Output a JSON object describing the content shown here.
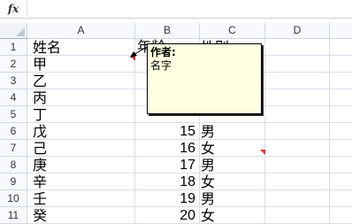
{
  "formula_bar": {
    "fx_label": "fx",
    "value": ""
  },
  "columns": [
    "A",
    "B",
    "C",
    "D"
  ],
  "rows": [
    {
      "num": "1",
      "a": "姓名",
      "b": "年龄",
      "c": "性别"
    },
    {
      "num": "2",
      "a": "甲",
      "b": "",
      "c": ""
    },
    {
      "num": "3",
      "a": "乙",
      "b": "",
      "c": ""
    },
    {
      "num": "4",
      "a": "丙",
      "b": "",
      "c": ""
    },
    {
      "num": "5",
      "a": "丁",
      "b": "",
      "c": ""
    },
    {
      "num": "6",
      "a": "戊",
      "b": "15",
      "c": "男"
    },
    {
      "num": "7",
      "a": "己",
      "b": "16",
      "c": "女"
    },
    {
      "num": "8",
      "a": "庚",
      "b": "17",
      "c": "男"
    },
    {
      "num": "9",
      "a": "辛",
      "b": "18",
      "c": "女"
    },
    {
      "num": "10",
      "a": "壬",
      "b": "19",
      "c": "男"
    },
    {
      "num": "11",
      "a": "癸",
      "b": "20",
      "c": "女"
    }
  ],
  "comment": {
    "author": "作者:",
    "text": "名字"
  },
  "colors": {
    "indicator": "#e0302c",
    "comment_bg": "#ffffe1",
    "header_bg": "#f7f9fc"
  }
}
